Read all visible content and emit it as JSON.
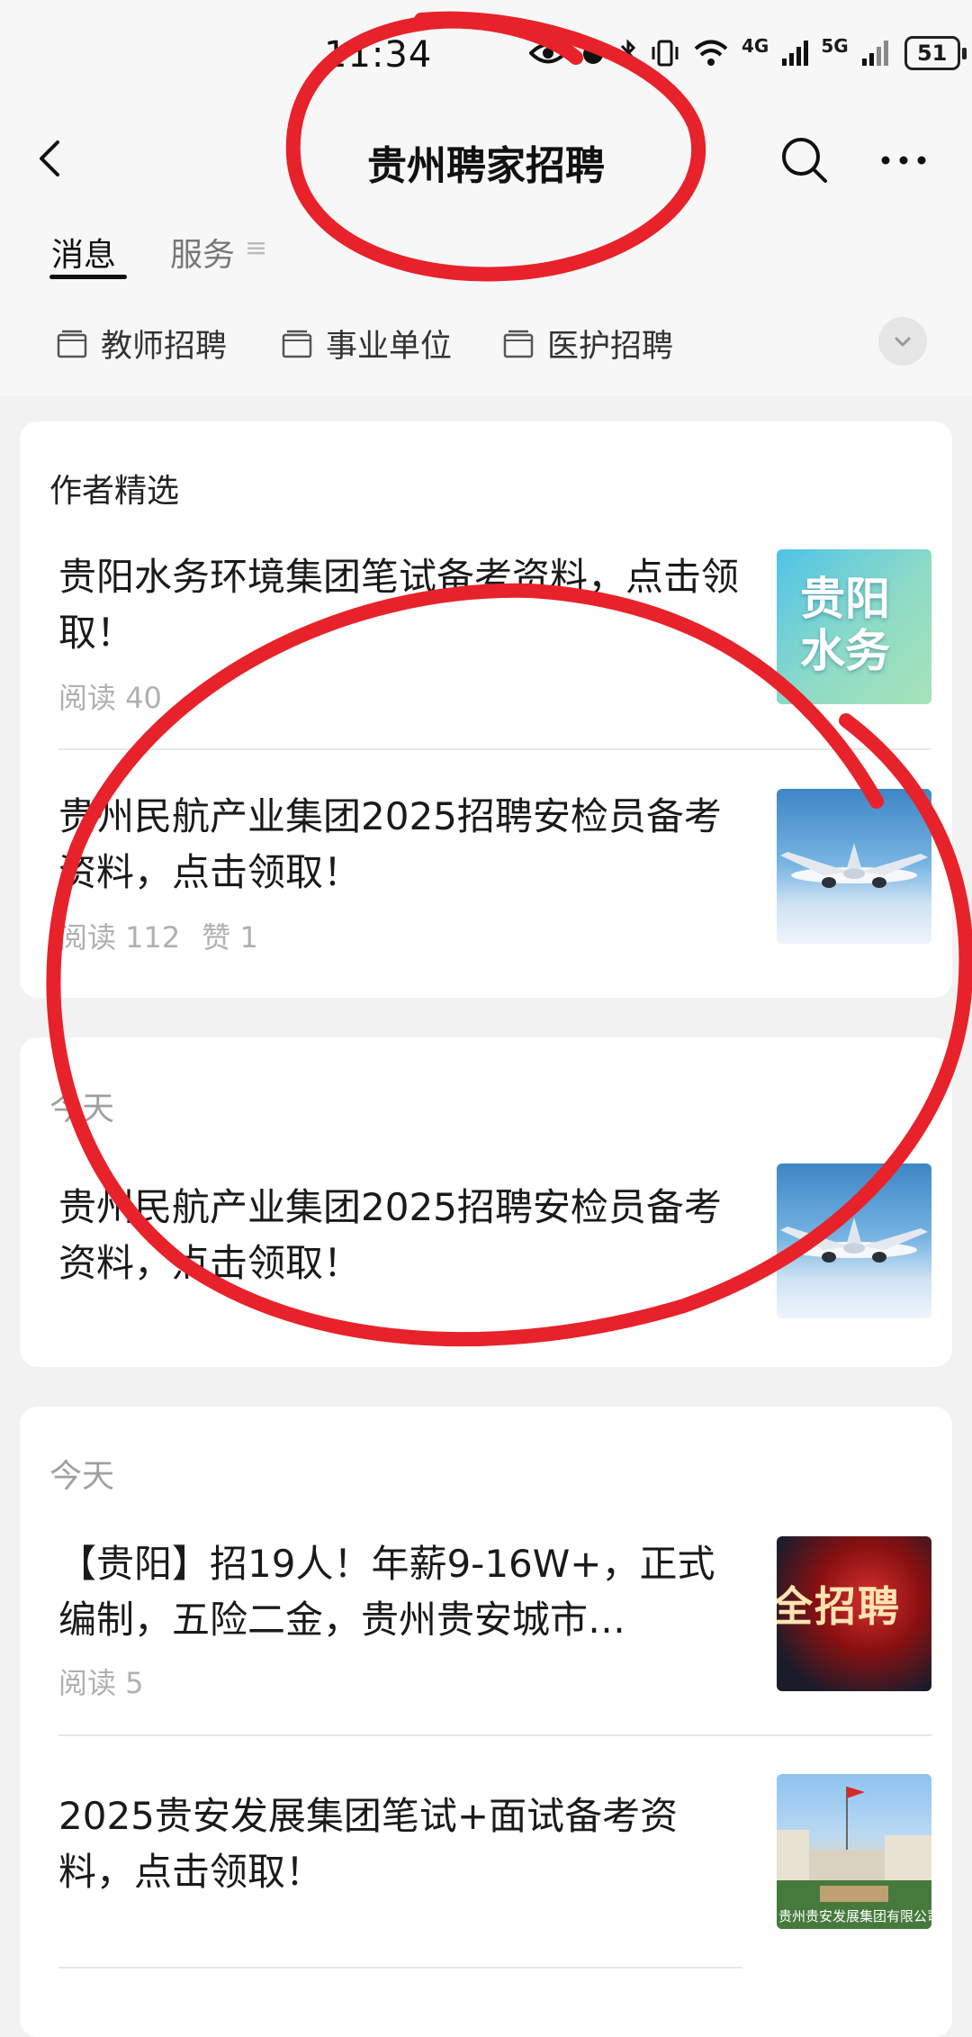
{
  "status_bar": {
    "time": "11:34",
    "battery": "51",
    "network_1": "4G",
    "network_2": "5G",
    "icons": [
      "eye-icon",
      "alarm-icon",
      "bluetooth-icon",
      "vibrate-icon",
      "wifi-icon",
      "signal-icon",
      "signal-icon",
      "battery-icon"
    ]
  },
  "header": {
    "title": "贵州聘家招聘",
    "back_icon": "chevron-left-icon",
    "search_icon": "search-icon",
    "more_icon": "more-horizontal-icon"
  },
  "tabs": [
    {
      "label": "消息",
      "active": true
    },
    {
      "label": "服务",
      "active": false,
      "icon": "menu-icon"
    }
  ],
  "categories": [
    {
      "label": "教师招聘",
      "icon": "folder-icon"
    },
    {
      "label": "事业单位",
      "icon": "folder-icon"
    },
    {
      "label": "医护招聘",
      "icon": "folder-icon"
    }
  ],
  "sections": [
    {
      "label": "作者精选",
      "articles": [
        {
          "title": "贵阳水务环境集团笔试备考资料，点击领取！",
          "reads": "阅读 40",
          "likes": "",
          "thumb_text": "贵阳\n水务"
        },
        {
          "title": "贵州民航产业集团2025招聘安检员备考资料，点击领取！",
          "reads": "阅读 112",
          "likes": "赞 1"
        }
      ]
    },
    {
      "label": "今天",
      "articles": [
        {
          "title": "贵州民航产业集团2025招聘安检员备考资料，点击领取！"
        }
      ]
    },
    {
      "label": "今天",
      "articles": [
        {
          "title": "【贵阳】招19人！年薪9-16W+，正式编制，五险二金，贵州贵安城市…",
          "reads": "阅读 5",
          "thumb_text": "全招聘"
        },
        {
          "title": "2025贵安发展集团笔试+面试备考资料，点击领取！",
          "thumb_text": "贵州贵安发展集团有限公司"
        }
      ]
    }
  ],
  "colors": {
    "annotation": "#e8222a",
    "background": "#f2f2f2",
    "card": "#ffffff"
  }
}
